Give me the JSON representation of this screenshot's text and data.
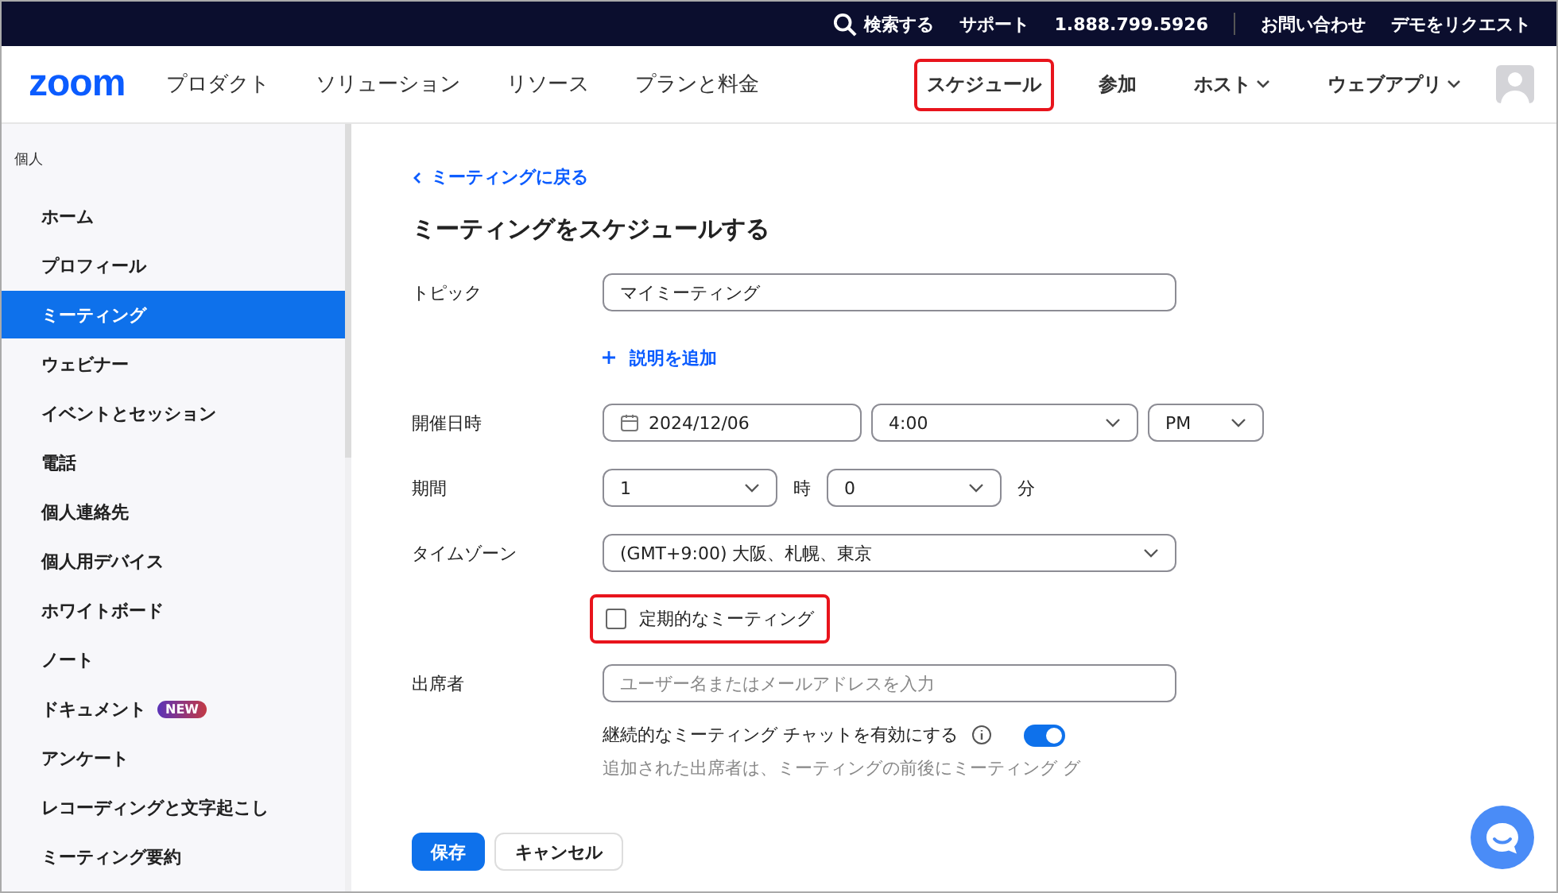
{
  "top_bar": {
    "search": "検索する",
    "links": [
      "サポート",
      "1.888.799.5926",
      "お問い合わせ",
      "デモをリクエスト"
    ]
  },
  "header": {
    "logo": "zoom",
    "nav": [
      "プロダクト",
      "ソリューション",
      "リソース",
      "プランと料金"
    ],
    "actions": [
      {
        "label": "スケジュール",
        "dropdown": false,
        "highlighted": true
      },
      {
        "label": "参加",
        "dropdown": false,
        "highlighted": false
      },
      {
        "label": "ホスト",
        "dropdown": true,
        "highlighted": false
      },
      {
        "label": "ウェブアプリ",
        "dropdown": true,
        "highlighted": false
      }
    ]
  },
  "sidebar": {
    "section": "個人",
    "items": [
      {
        "label": "ホーム",
        "selected": false
      },
      {
        "label": "プロフィール",
        "selected": false
      },
      {
        "label": "ミーティング",
        "selected": true
      },
      {
        "label": "ウェビナー",
        "selected": false
      },
      {
        "label": "イベントとセッション",
        "selected": false
      },
      {
        "label": "電話",
        "selected": false
      },
      {
        "label": "個人連絡先",
        "selected": false
      },
      {
        "label": "個人用デバイス",
        "selected": false
      },
      {
        "label": "ホワイトボード",
        "selected": false
      },
      {
        "label": "ノート",
        "selected": false
      },
      {
        "label": "ドキュメント",
        "selected": false,
        "badge": "NEW"
      },
      {
        "label": "アンケート",
        "selected": false
      },
      {
        "label": "レコーディングと文字起こし",
        "selected": false
      },
      {
        "label": "ミーティング要約",
        "selected": false
      }
    ]
  },
  "form": {
    "back_link": "ミーティングに戻る",
    "title": "ミーティングをスケジュールする",
    "topic": {
      "label": "トピック",
      "value": "マイミーティング"
    },
    "add_description": "説明を追加",
    "when": {
      "label": "開催日時",
      "date": "2024/12/06",
      "time": "4:00",
      "ampm": "PM"
    },
    "duration": {
      "label": "期間",
      "hours": "1",
      "hours_unit": "時",
      "minutes": "0",
      "minutes_unit": "分"
    },
    "timezone": {
      "label": "タイムゾーン",
      "value": "(GMT+9:00) 大阪、札幌、東京"
    },
    "recurring": {
      "label": "定期的なミーティング",
      "checked": false,
      "highlighted": true
    },
    "attendees": {
      "label": "出席者",
      "placeholder": "ユーザー名またはメールアドレスを入力"
    },
    "chat": {
      "label": "継続的なミーティング チャットを有効にする",
      "on": true,
      "help": "追加された出席者は、ミーティングの前後にミーティング グ"
    },
    "buttons": {
      "save": "保存",
      "cancel": "キャンセル"
    }
  }
}
